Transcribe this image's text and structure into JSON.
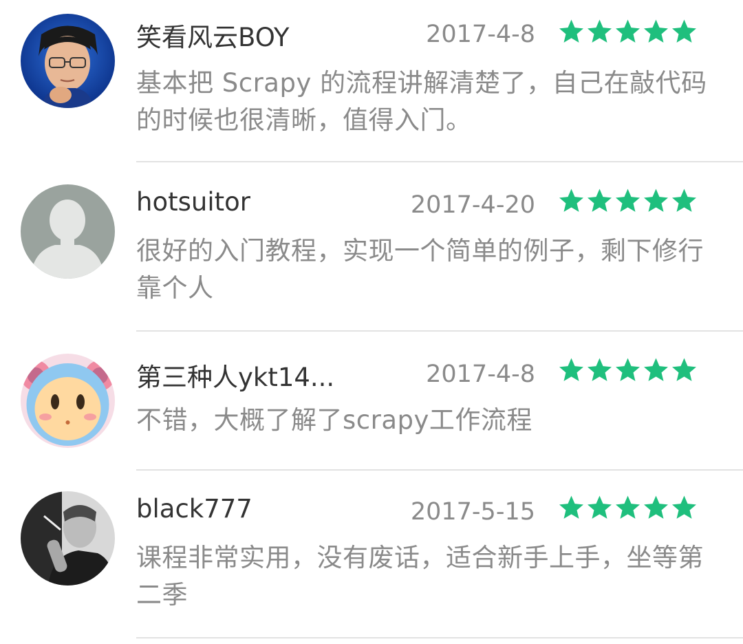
{
  "reviews": [
    {
      "username": "笑看风云BOY",
      "date": "2017-4-8",
      "rating": 5,
      "comment": "基本把 Scrapy 的流程讲解清楚了，自己在敲代码的时候也很清晰，值得入门。",
      "avatar": "portrait-man-glasses-photo"
    },
    {
      "username": "hotsuitor",
      "date": "2017-4-20",
      "rating": 5,
      "comment": "很好的入门教程，实现一个简单的例子，剩下修行靠个人",
      "avatar": "default-silhouette"
    },
    {
      "username": "第三种人ykt14...",
      "date": "2017-4-8",
      "rating": 5,
      "comment": "不错，大概了解了scrapy工作流程",
      "avatar": "cartoon-character"
    },
    {
      "username": "black777",
      "date": "2017-5-15",
      "rating": 5,
      "comment": "课程非常实用，没有废话，适合新手上手，坐等第二季",
      "avatar": "black-and-white-photo"
    }
  ],
  "colors": {
    "star": "#1fbf7d",
    "username": "#333333",
    "meta_text": "#8a8a8a",
    "divider": "#e2e2e2"
  }
}
